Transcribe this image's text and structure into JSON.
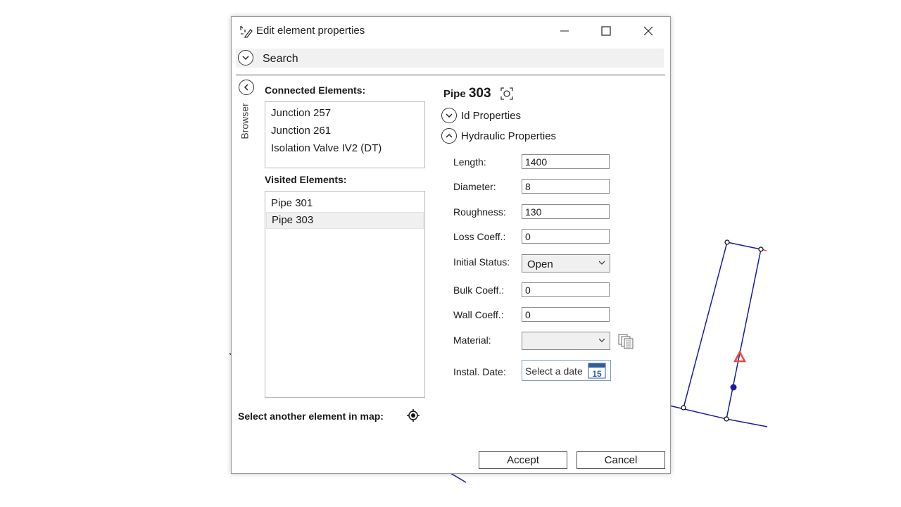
{
  "window": {
    "title": "Edit element properties"
  },
  "search": {
    "label": "Search"
  },
  "browser_tab": {
    "label": "Browser"
  },
  "connected": {
    "label": "Connected Elements:",
    "items": [
      "Junction 257",
      "Junction 261",
      "Isolation Valve IV2 (DT)"
    ]
  },
  "visited": {
    "label": "Visited Elements:",
    "items": [
      "Pipe 301",
      "Pipe 303"
    ],
    "selected": "Pipe 303"
  },
  "element": {
    "type": "Pipe",
    "id": "303"
  },
  "sections": {
    "id_props": "Id Properties",
    "hydraulic_props": "Hydraulic Properties"
  },
  "properties": {
    "length": {
      "label": "Length:",
      "value": "1400"
    },
    "diameter": {
      "label": "Diameter:",
      "value": "8"
    },
    "roughness": {
      "label": "Roughness:",
      "value": "130"
    },
    "loss_coeff": {
      "label": "Loss Coeff.:",
      "value": "0"
    },
    "initial_status": {
      "label": "Initial Status:",
      "value": "Open"
    },
    "bulk_coeff": {
      "label": "Bulk Coeff.:",
      "value": "0"
    },
    "wall_coeff": {
      "label": "Wall Coeff.:",
      "value": "0"
    },
    "material": {
      "label": "Material:",
      "value": ""
    },
    "install_date": {
      "label": "Instal. Date:",
      "placeholder": "Select a date",
      "calendar_day": "15"
    }
  },
  "select_in_map": {
    "label": "Select another element in map:"
  },
  "buttons": {
    "accept": "Accept",
    "cancel": "Cancel"
  },
  "colors": {
    "map_line": "#1a1aa0",
    "warning": "#e8483a",
    "date_border": "#7d9bc4"
  }
}
